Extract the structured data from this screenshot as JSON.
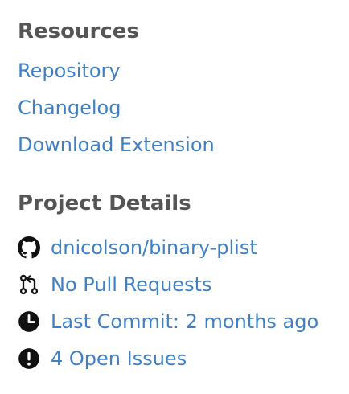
{
  "resources": {
    "heading": "Resources",
    "links": [
      {
        "label": "Repository"
      },
      {
        "label": "Changelog"
      },
      {
        "label": "Download Extension"
      }
    ]
  },
  "project_details": {
    "heading": "Project Details",
    "items": [
      {
        "icon": "github-icon",
        "label": "dnicolson/binary-plist"
      },
      {
        "icon": "pull-request-icon",
        "label": "No Pull Requests"
      },
      {
        "icon": "clock-icon",
        "label": "Last Commit: 2 months ago"
      },
      {
        "icon": "issue-icon",
        "label": "4 Open Issues"
      }
    ]
  },
  "colors": {
    "heading": "#555555",
    "link": "#3f7fc4",
    "icon": "#111111"
  }
}
